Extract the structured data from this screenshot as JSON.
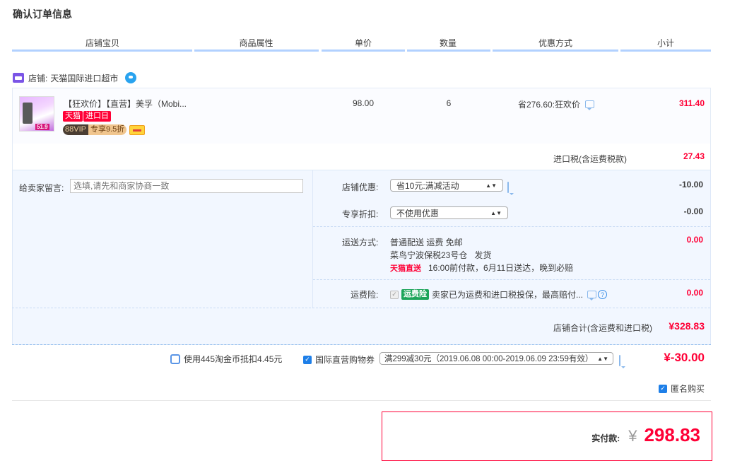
{
  "page_title": "确认订单信息",
  "columns": [
    "店铺宝贝",
    "商品属性",
    "单价",
    "数量",
    "优惠方式",
    "小计"
  ],
  "store": {
    "label": "店铺:",
    "name": "天猫国际进口超市"
  },
  "item": {
    "title": "【狂欢价】【直营】美孚（Mobi...",
    "badge_tmall": "天猫",
    "badge_import": "进口日",
    "vip_label": "88VIP",
    "vip_discount": "专享9.5折",
    "thumb_price": "51.9",
    "unit_price": "98.00",
    "quantity": "6",
    "discount": "省276.60:狂欢价",
    "subtotal": "311.40"
  },
  "import_tax": {
    "label": "进口税(含运费税款)",
    "value": "27.43"
  },
  "message": {
    "label": "给卖家留言:",
    "placeholder": "选填,请先和商家协商一致"
  },
  "store_discount": {
    "label": "店铺优惠:",
    "selected": "省10元:满减活动",
    "value": "-10.00"
  },
  "exclusive_discount": {
    "label": "专享折扣:",
    "selected": "不使用优惠",
    "value": "-0.00"
  },
  "shipping": {
    "label": "运送方式:",
    "line1": "普通配送 运费 免邮",
    "line2": "菜鸟宁波保税23号仓   发货",
    "direct_label": "天猫直送",
    "line3": "16:00前付款，6月11日送达，晚到必赔",
    "value": "0.00"
  },
  "insurance": {
    "label": "运费险:",
    "badge": "运费险",
    "text": "卖家已为运费和进口税投保，最高赔付...",
    "value": "0.00"
  },
  "store_total": {
    "label": "店铺合计(含运费和进口税)",
    "value": "¥328.83"
  },
  "coin": {
    "label": "使用445淘金币抵扣4.45元"
  },
  "coupon": {
    "label": "国际直营购物券",
    "selected": "满299减30元（2019.06.08 00:00-2019.06.09 23:59有效）",
    "value": "¥-30.00"
  },
  "anonymous": {
    "label": "匿名购买"
  },
  "pay": {
    "label": "实付款:",
    "currency": "¥",
    "amount": "298.83"
  },
  "colors": {
    "accent_red": "#ff0036",
    "header_line": "#b2d1ff",
    "panel_blue": "#f2f7ff"
  }
}
